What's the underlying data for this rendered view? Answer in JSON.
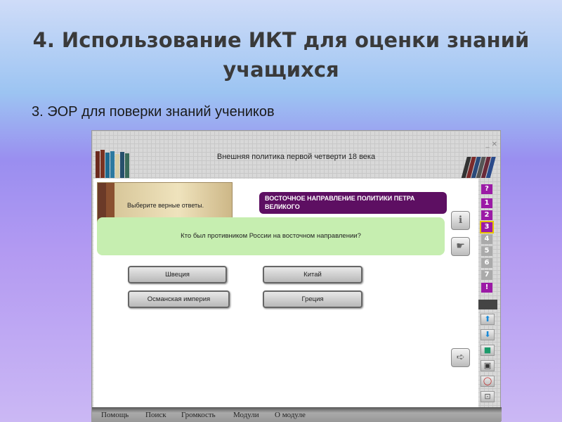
{
  "slide": {
    "title": "4. Использование ИКТ для оценки знаний учащихся",
    "subtitle": "3. ЭОР для поверки знаний учеников"
  },
  "app": {
    "header": "Внешняя политика первой четверти 18 века",
    "instruction": "Выберите верные ответы.",
    "topic": "ВОСТОЧНОЕ НАПРАВЛЕНИЕ ПОЛИТИКИ ПЕТРА ВЕЛИКОГО",
    "question": "Кто был противником России на восточном направлении?",
    "answers": [
      "Швеция",
      "Китай",
      "Османская империя",
      "Греция"
    ],
    "nav": [
      "?",
      "1",
      "2",
      "3",
      "4",
      "5",
      "6",
      "7",
      "!"
    ],
    "current": "3",
    "menu": [
      "Помощь",
      "Поиск",
      "Громкость",
      "Модули",
      "О модуле"
    ]
  }
}
